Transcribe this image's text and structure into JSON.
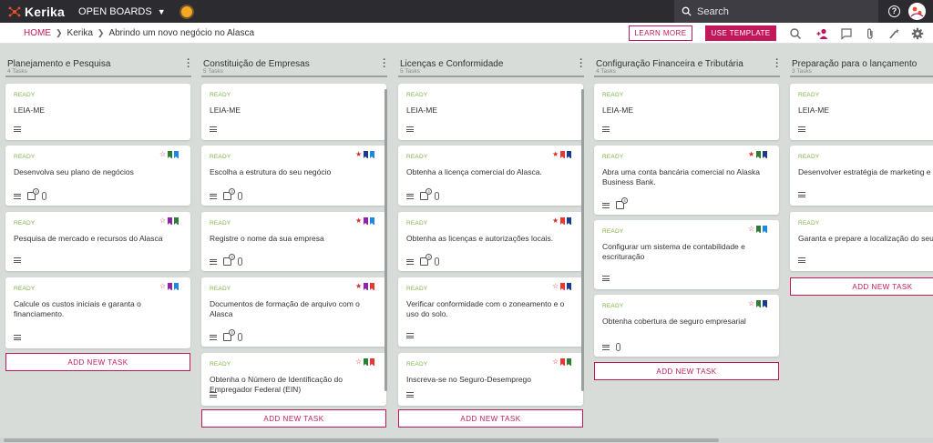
{
  "app": {
    "name": "Kerika",
    "boards_menu": "OPEN BOARDS"
  },
  "search": {
    "placeholder": "Search"
  },
  "breadcrumb": {
    "home": "HOME",
    "org": "Kerika",
    "board": "Abrindo um novo negócio no Alasca"
  },
  "toolbar": {
    "learn_more": "LEARN MORE",
    "use_template": "USE TEMPLATE"
  },
  "colors": {
    "accent": "#c2185b",
    "status_ready": "#7cb342",
    "topbar": "#2b2b30",
    "background": "#d7dcd9"
  },
  "columns": [
    {
      "title": "Planejamento e Pesquisa",
      "count": "4 Tasks",
      "cards": [
        {
          "status": "READY",
          "title": "LEIA-ME",
          "flags": [],
          "checklist": null,
          "attachment": false
        },
        {
          "status": "READY",
          "title": "Desenvolva seu plano de negócios",
          "flags": [
            "star-empty",
            "bm-green",
            "bm-blue"
          ],
          "checklist": "4",
          "attachment": true
        },
        {
          "status": "READY",
          "title": "Pesquisa de mercado e recursos do Alasca",
          "flags": [
            "star-empty",
            "bm-purple",
            "bm-green"
          ],
          "checklist": null,
          "attachment": false
        },
        {
          "status": "READY",
          "title": "Calcule os custos iniciais e garanta o financiamento.",
          "flags": [
            "star-empty",
            "bm-purple",
            "bm-blue"
          ],
          "checklist": null,
          "attachment": false
        }
      ],
      "add_label": "ADD NEW TASK"
    },
    {
      "title": "Constituição de Empresas",
      "count": "5 Tasks",
      "cards": [
        {
          "status": "READY",
          "title": "LEIA-ME",
          "flags": [],
          "checklist": null,
          "attachment": false
        },
        {
          "status": "READY",
          "title": "Escolha a estrutura do seu negócio",
          "flags": [
            "star-filled",
            "bm-navy",
            "bm-blue"
          ],
          "checklist": "4",
          "attachment": true
        },
        {
          "status": "READY",
          "title": "Registre o nome da sua empresa",
          "flags": [
            "star-filled",
            "bm-purple",
            "bm-blue"
          ],
          "checklist": "4",
          "attachment": true
        },
        {
          "status": "READY",
          "title": "Documentos de formação de arquivo com o Alasca",
          "flags": [
            "star-filled",
            "bm-purple",
            "bm-red"
          ],
          "checklist": "4",
          "attachment": true
        },
        {
          "status": "READY",
          "title": "Obtenha o Número de Identificação do Empregador Federal (EIN)",
          "flags": [
            "star-empty",
            "bm-green",
            "bm-red"
          ],
          "checklist": null,
          "attachment": false
        }
      ],
      "add_label": "ADD NEW TASK"
    },
    {
      "title": "Licenças e Conformidade",
      "count": "5 Tasks",
      "cards": [
        {
          "status": "READY",
          "title": "LEIA-ME",
          "flags": [],
          "checklist": null,
          "attachment": false
        },
        {
          "status": "READY",
          "title": "Obtenha a licença comercial do Alasca.",
          "flags": [
            "star-filled",
            "bm-red",
            "bm-navy"
          ],
          "checklist": "4",
          "attachment": true
        },
        {
          "status": "READY",
          "title": "Obtenha as licenças e autorizações locais.",
          "flags": [
            "star-filled",
            "bm-red",
            "bm-navy"
          ],
          "checklist": "4",
          "attachment": true
        },
        {
          "status": "READY",
          "title": "Verificar conformidade com o zoneamento e o uso do solo.",
          "flags": [
            "star-empty",
            "bm-red",
            "bm-navy"
          ],
          "checklist": null,
          "attachment": false
        },
        {
          "status": "READY",
          "title": "Inscreva-se no Seguro-Desemprego",
          "flags": [
            "star-empty",
            "bm-red",
            "bm-green"
          ],
          "checklist": null,
          "attachment": false
        }
      ],
      "add_label": "ADD NEW TASK"
    },
    {
      "title": "Configuração Financeira e Tributária",
      "count": "4 Tasks",
      "cards": [
        {
          "status": "READY",
          "title": "LEIA-ME",
          "flags": [],
          "checklist": null,
          "attachment": false
        },
        {
          "status": "READY",
          "title": "Abra uma conta bancária comercial no Alaska Business Bank.",
          "flags": [
            "star-filled",
            "bm-green",
            "bm-navy"
          ],
          "checklist": "4",
          "attachment": false
        },
        {
          "status": "READY",
          "title": "Configurar um sistema de contabilidade e escrituração",
          "flags": [
            "star-empty",
            "bm-green",
            "bm-blue"
          ],
          "checklist": null,
          "attachment": false
        },
        {
          "status": "READY",
          "title": "Obtenha cobertura de seguro empresarial",
          "flags": [
            "star-empty",
            "bm-green",
            "bm-navy"
          ],
          "checklist": null,
          "attachment": true
        }
      ],
      "add_label": "ADD NEW TASK"
    },
    {
      "title": "Preparação para o lançamento",
      "count": "3 Tasks",
      "cards": [
        {
          "status": "READY",
          "title": "LEIA-ME",
          "flags": [],
          "checklist": null,
          "attachment": false
        },
        {
          "status": "READY",
          "title": "Desenvolver estratégia de marketing e b",
          "flags": [],
          "checklist": null,
          "attachment": false
        },
        {
          "status": "READY",
          "title": "Garanta e prepare a localização do seu r",
          "flags": [],
          "checklist": null,
          "attachment": false
        }
      ],
      "add_label": "ADD NEW TASK"
    }
  ]
}
